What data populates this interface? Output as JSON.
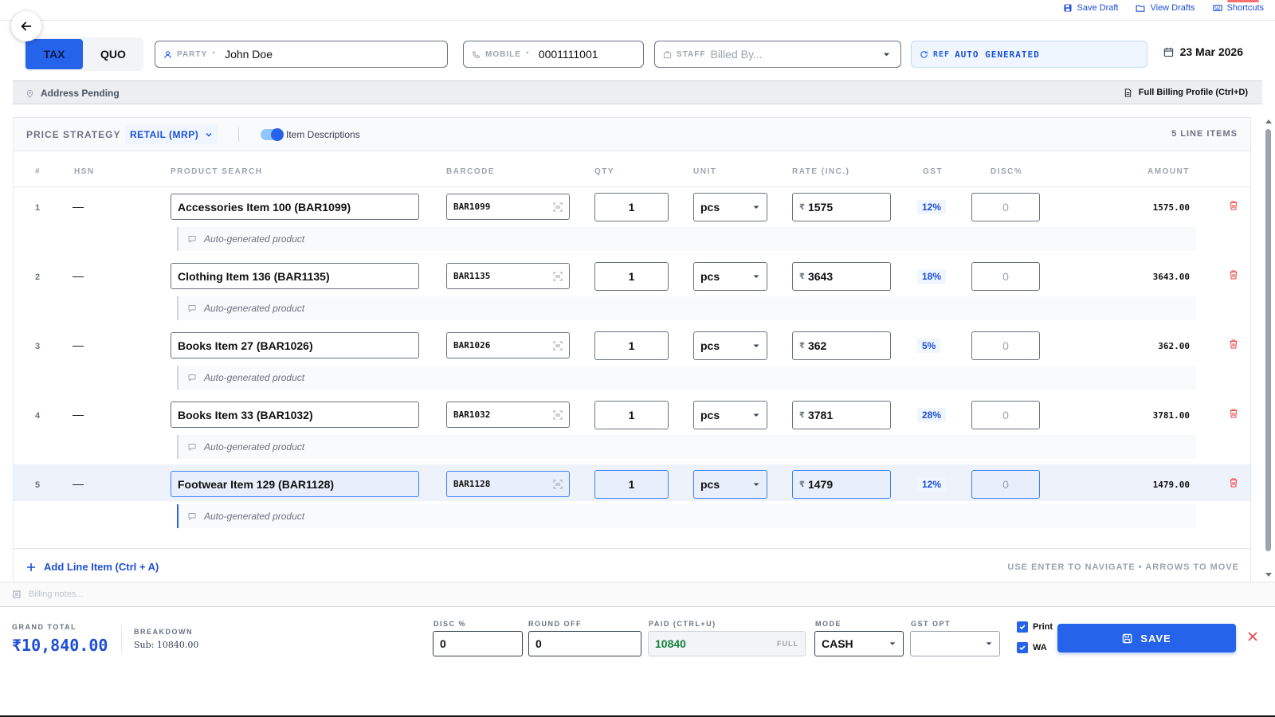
{
  "topbar": {
    "save_draft": "Save Draft",
    "view_drafts": "View Drafts",
    "shortcuts": "Shortcuts"
  },
  "header": {
    "doc_types": [
      "TAX",
      "QUO"
    ],
    "active_doc_type": "TAX",
    "party": {
      "label": "PARTY",
      "value": "John Doe"
    },
    "mobile": {
      "label": "MOBILE",
      "value": "0001111001"
    },
    "staff": {
      "label": "STAFF",
      "placeholder": "Billed By..."
    },
    "ref": {
      "label": "REF",
      "value": "AUTO GENERATED"
    },
    "date": "23 Mar 2026"
  },
  "address": {
    "status": "Address Pending",
    "profile_link": "Full Billing Profile (Ctrl+D)"
  },
  "strategy": {
    "label": "PRICE STRATEGY",
    "value": "RETAIL (MRP)",
    "toggle_label": "Item Descriptions",
    "toggle_on": true,
    "line_count": "5 LINE ITEMS"
  },
  "table": {
    "columns": [
      "#",
      "HSN",
      "PRODUCT SEARCH",
      "BARCODE",
      "QTY",
      "UNIT",
      "RATE (INC.)",
      "GST",
      "DISC%",
      "AMOUNT"
    ],
    "currency_symbol": "₹",
    "rows": [
      {
        "num": "1",
        "hsn": "—",
        "product": "Accessories Item 100 (BAR1099)",
        "barcode": "BAR1099",
        "qty": "1",
        "unit": "pcs",
        "rate": "1575",
        "gst": "12%",
        "disc": "0",
        "amount": "1575.00",
        "desc": "Auto-generated product"
      },
      {
        "num": "2",
        "hsn": "—",
        "product": "Clothing Item 136 (BAR1135)",
        "barcode": "BAR1135",
        "qty": "1",
        "unit": "pcs",
        "rate": "3643",
        "gst": "18%",
        "disc": "0",
        "amount": "3643.00",
        "desc": "Auto-generated product"
      },
      {
        "num": "3",
        "hsn": "—",
        "product": "Books Item 27 (BAR1026)",
        "barcode": "BAR1026",
        "qty": "1",
        "unit": "pcs",
        "rate": "362",
        "gst": "5%",
        "disc": "0",
        "amount": "362.00",
        "desc": "Auto-generated product"
      },
      {
        "num": "4",
        "hsn": "—",
        "product": "Books Item 33 (BAR1032)",
        "barcode": "BAR1032",
        "qty": "1",
        "unit": "pcs",
        "rate": "3781",
        "gst": "28%",
        "disc": "0",
        "amount": "3781.00",
        "desc": "Auto-generated product"
      },
      {
        "num": "5",
        "hsn": "—",
        "product": "Footwear Item 129 (BAR1128)",
        "barcode": "BAR1128",
        "qty": "1",
        "unit": "pcs",
        "rate": "1479",
        "gst": "12%",
        "disc": "0",
        "amount": "1479.00",
        "desc": "Auto-generated product"
      }
    ],
    "add_line": "Add Line Item (Ctrl + A)",
    "nav_hint": "USE ENTER TO NAVIGATE • ARROWS TO MOVE"
  },
  "notes": {
    "placeholder": "Billing notes..."
  },
  "footer": {
    "grand_total_label": "GRAND TOTAL",
    "grand_total": "₹10,840.00",
    "breakdown_label": "BREAKDOWN",
    "subtotal": "Sub: 10840.00",
    "disc_label": "DISC %",
    "disc_value": "0",
    "round_label": "ROUND OFF",
    "round_value": "0",
    "paid_label": "PAID (CTRL+U)",
    "paid_value": "10840",
    "paid_tag": "FULL",
    "mode_label": "MODE",
    "mode_value": "CASH",
    "gst_opt_label": "GST OPT",
    "gst_opt_value": "",
    "print_label": "Print",
    "wa_label": "WA",
    "save_label": "SAVE"
  },
  "colors": {
    "accent": "#2563eb",
    "danger": "#ef4444",
    "paid_green": "#15803d"
  }
}
